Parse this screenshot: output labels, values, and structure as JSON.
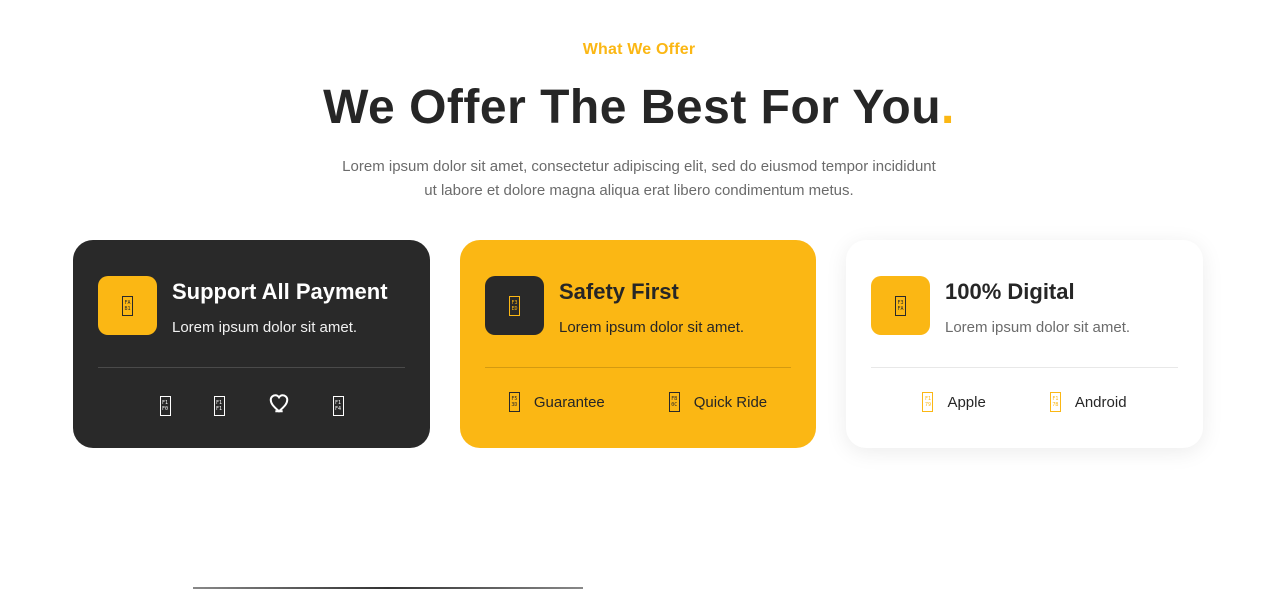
{
  "section": {
    "eyebrow": "What We Offer",
    "title": "We Offer The Best For You",
    "title_dot": ".",
    "subtitle_line1": "Lorem ipsum dolor sit amet, consectetur adipiscing elit, sed do eiusmod tempor incididunt",
    "subtitle_line2": "ut labore et dolore magna aliqua erat libero condimentum metus."
  },
  "colors": {
    "accent": "#fbb714",
    "dark": "#292929",
    "text": "#262626",
    "muted": "#6b6b6b"
  },
  "cards": [
    {
      "title": "Support All Payment",
      "text": "Lorem ipsum dolor sit amet.",
      "icon": "wallet-icon",
      "payment_icons": [
        "credit-card-icon",
        "paypal-icon",
        "heart-icon",
        "bank-icon"
      ]
    },
    {
      "title": "Safety First",
      "text": "Lorem ipsum dolor sit amet.",
      "icon": "shield-icon",
      "features": [
        {
          "label": "Guarantee",
          "icon": "badge-icon"
        },
        {
          "label": "Quick Ride",
          "icon": "car-icon"
        }
      ]
    },
    {
      "title": "100% Digital",
      "text": "Lorem ipsum dolor sit amet.",
      "icon": "phone-icon",
      "features": [
        {
          "label": "Apple",
          "icon": "apple-icon"
        },
        {
          "label": "Android",
          "icon": "android-icon"
        }
      ]
    }
  ]
}
